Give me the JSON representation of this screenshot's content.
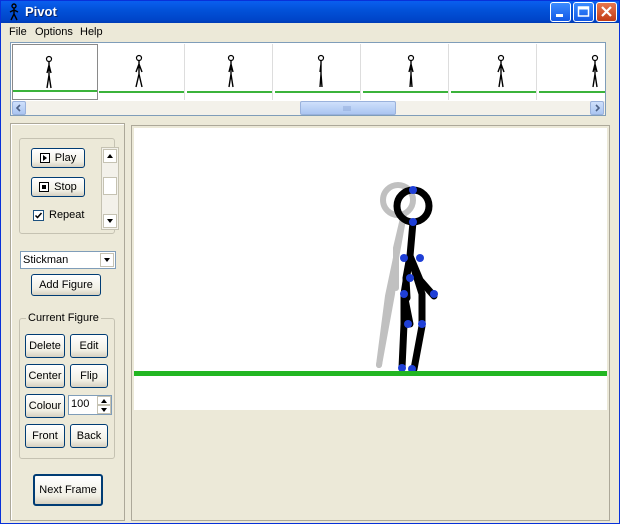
{
  "window": {
    "title": "Pivot",
    "colors": {
      "titlebar": "#0052d9",
      "ground": "#22b622",
      "joint": "#1f3fd6",
      "ghost": "#c0c0c0"
    }
  },
  "menu": {
    "file": "File",
    "options": "Options",
    "help": "Help"
  },
  "timeline": {
    "frame_count": 7,
    "selected_frame": 1
  },
  "controls": {
    "play": "Play",
    "stop": "Stop",
    "repeat": "Repeat",
    "repeat_checked": true
  },
  "figure_select": {
    "value": "Stickman"
  },
  "add_figure": "Add Figure",
  "current_figure": {
    "label": "Current Figure",
    "delete": "Delete",
    "edit": "Edit",
    "center": "Center",
    "flip": "Flip",
    "colour": "Colour",
    "colour_value": "100",
    "front": "Front",
    "back": "Back"
  },
  "next_frame": "Next Frame"
}
